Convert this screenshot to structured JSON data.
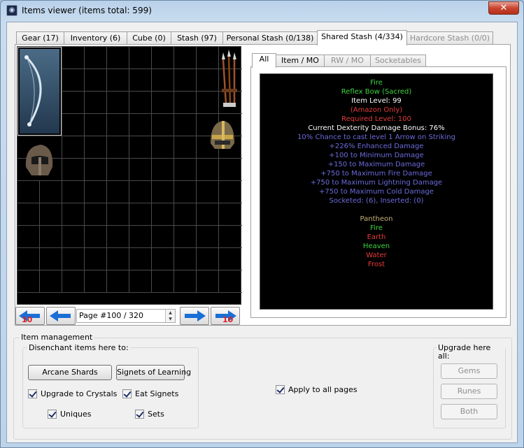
{
  "window": {
    "title": "Items viewer (items total: 599)",
    "close_glyph": "✕",
    "icon": "app-icon"
  },
  "tabs": [
    {
      "label": "Gear (17)",
      "state": "normal"
    },
    {
      "label": "Inventory (6)",
      "state": "normal"
    },
    {
      "label": "Cube (0)",
      "state": "normal"
    },
    {
      "label": "Stash (97)",
      "state": "normal"
    },
    {
      "label": "Personal Stash (0/138)",
      "state": "normal"
    },
    {
      "label": "Shared Stash (4/334)",
      "state": "active"
    },
    {
      "label": "Hardcore Stash (0/0)",
      "state": "disabled"
    }
  ],
  "grid": {
    "items": [
      {
        "name": "reflex-bow",
        "icon": "bow-icon"
      },
      {
        "name": "arrows",
        "icon": "arrows-icon"
      },
      {
        "name": "helm-gold",
        "icon": "helm-icon"
      },
      {
        "name": "helm-dark",
        "icon": "helm-icon"
      }
    ]
  },
  "navigation": {
    "page_value": "Page #100 / 320",
    "prev10_badge": "10",
    "next10_badge": "10",
    "arrow_color": "#1a6fd6",
    "badge_color": "#e02020"
  },
  "subtabs": [
    {
      "label": "All",
      "state": "active"
    },
    {
      "label": "Item / MO",
      "state": "normal"
    },
    {
      "label": "RW / MO",
      "state": "disabled"
    },
    {
      "label": "Socketables",
      "state": "disabled"
    }
  ],
  "description": {
    "lines": [
      {
        "text": "Fire",
        "color": "green"
      },
      {
        "text": "Reflex Bow (Sacred)",
        "color": "green"
      },
      {
        "text": "Item Level: 99",
        "color": "white"
      },
      {
        "text": "(Amazon Only)",
        "color": "red"
      },
      {
        "text": "Required Level: 100",
        "color": "red"
      },
      {
        "text": "Current Dexterity Damage Bonus: 76%",
        "color": "white"
      },
      {
        "text": "10% Chance to cast level 1 Arrow on Striking",
        "color": "blue"
      },
      {
        "text": "+226% Enhanced Damage",
        "color": "blue"
      },
      {
        "text": "+100 to Minimum Damage",
        "color": "blue"
      },
      {
        "text": "+150 to Maximum Damage",
        "color": "blue"
      },
      {
        "text": "+750 to Maximum Fire Damage",
        "color": "blue"
      },
      {
        "text": "+750 to Maximum Lightning Damage",
        "color": "blue"
      },
      {
        "text": "+750 to Maximum Cold Damage",
        "color": "blue"
      },
      {
        "text": "Socketed: (6), Inserted: (0)",
        "color": "blue"
      },
      {
        "text": "",
        "color": "white"
      },
      {
        "text": "Pantheon",
        "color": "gold"
      },
      {
        "text": "Fire",
        "color": "green"
      },
      {
        "text": "Earth",
        "color": "red"
      },
      {
        "text": "Heaven",
        "color": "green"
      },
      {
        "text": "Water",
        "color": "red"
      },
      {
        "text": "Frost",
        "color": "red"
      }
    ]
  },
  "management": {
    "title": "Item management",
    "disenchant": {
      "title": "Disenchant items here to:",
      "arcane_button": "Arcane Shards",
      "signets_button": "Signets of Learning",
      "upgrade_crystals": "Upgrade to Crystals",
      "eat_signets": "Eat Signets",
      "uniques": "Uniques",
      "sets": "Sets"
    },
    "apply_all": "Apply to all pages",
    "upgrade": {
      "title": "Upgrade here all:",
      "gems": "Gems",
      "runes": "Runes",
      "both": "Both"
    }
  }
}
